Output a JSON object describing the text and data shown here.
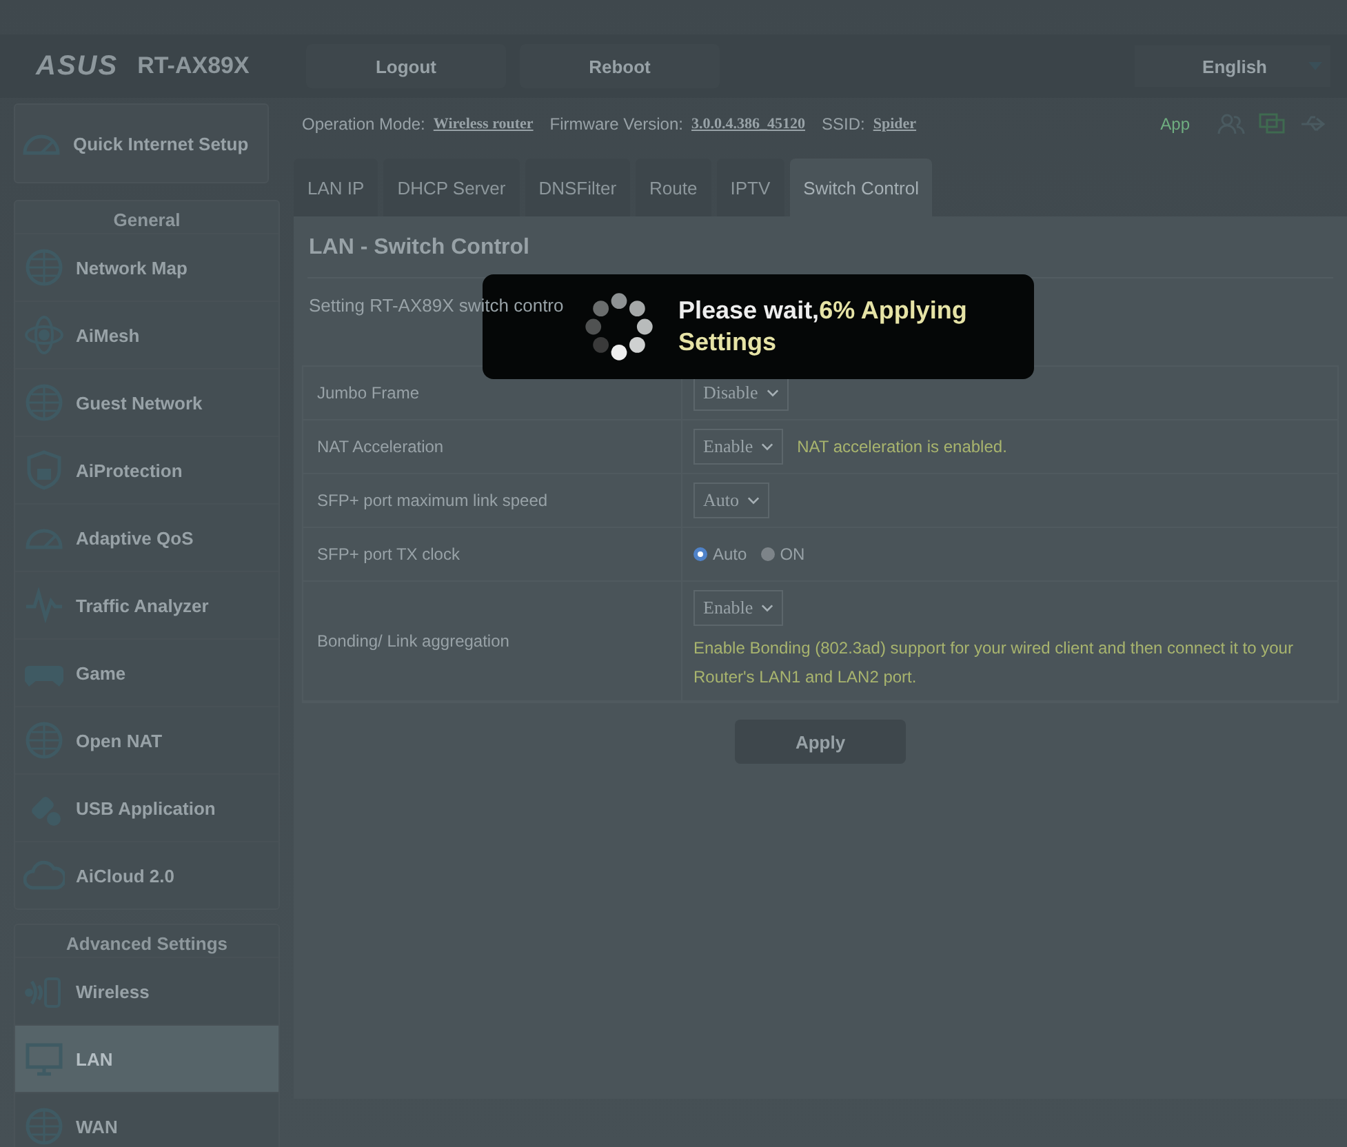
{
  "header": {
    "logo": "ASUS",
    "model": "RT-AX89X",
    "buttons": [
      "Logout",
      "Reboot"
    ],
    "language": "English"
  },
  "info": {
    "mode_label": "Operation Mode:",
    "mode": "Wireless router",
    "fw_label": "Firmware Version:",
    "fw": "3.0.0.4.386_45120",
    "ssid_label": "SSID:",
    "ssid": "Spider",
    "app": "App"
  },
  "sidebar": {
    "quick_setup": "Quick Internet Setup",
    "general_title": "General",
    "general": [
      {
        "label": "Network Map",
        "selected": false
      },
      {
        "label": "AiMesh",
        "selected": false
      },
      {
        "label": "Guest Network",
        "selected": false
      },
      {
        "label": "AiProtection",
        "selected": false
      },
      {
        "label": "Adaptive QoS",
        "selected": false
      },
      {
        "label": "Traffic Analyzer",
        "selected": false
      },
      {
        "label": "Game",
        "selected": false
      },
      {
        "label": "Open NAT",
        "selected": false
      },
      {
        "label": "USB Application",
        "selected": false
      },
      {
        "label": "AiCloud 2.0",
        "selected": false
      }
    ],
    "advanced_title": "Advanced Settings",
    "advanced": [
      {
        "label": "Wireless",
        "selected": false
      },
      {
        "label": "LAN",
        "selected": true
      },
      {
        "label": "WAN",
        "selected": false
      }
    ]
  },
  "tabs": [
    {
      "label": "LAN IP",
      "selected": false
    },
    {
      "label": "DHCP Server",
      "selected": false
    },
    {
      "label": "DNSFilter",
      "selected": false
    },
    {
      "label": "Route",
      "selected": false
    },
    {
      "label": "IPTV",
      "selected": false
    },
    {
      "label": "Switch Control",
      "selected": true
    }
  ],
  "page": {
    "title": "LAN - Switch Control",
    "description": "Setting RT-AX89X switch contro"
  },
  "settings": [
    {
      "kind": "select",
      "label": "Jumbo Frame",
      "value": "Disable"
    },
    {
      "kind": "select",
      "label": "NAT Acceleration",
      "value": "Enable",
      "note": "NAT acceleration is enabled."
    },
    {
      "kind": "select",
      "label": "SFP+ port maximum link speed",
      "value": "Auto"
    },
    {
      "kind": "radio",
      "label": "SFP+ port TX clock",
      "options": [
        {
          "label": "Auto",
          "selected": true
        },
        {
          "label": "ON",
          "selected": false
        }
      ]
    },
    {
      "kind": "select",
      "label": "Bonding/ Link aggregation",
      "value": "Enable",
      "note": "Enable Bonding (802.3ad) support for your wired client and then connect it to your Router's LAN1 and LAN2 port.",
      "note_below": true
    }
  ],
  "apply": "Apply",
  "loading": {
    "wait_text": "Please wait,",
    "progress_text": "6% Applying Settings"
  }
}
